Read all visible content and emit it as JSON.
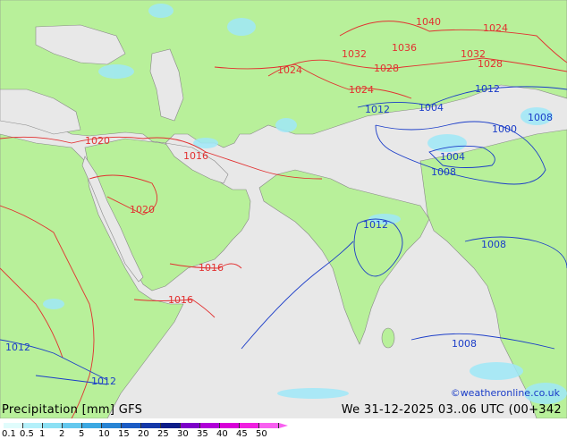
{
  "title": "Precipitation [mm]  GFS",
  "run_info": "We 31-12-2025 03..06 UTC (00+342",
  "credit": "©weatheronline.co.uk",
  "colors": {
    "land": "#b8f09a",
    "sea": "#e8e8e8",
    "isobar_high": "#e23030",
    "isobar_low": "#1a3cc8",
    "precip_light": "#9fe8f8"
  },
  "legend": {
    "ticks": [
      "0.1",
      "0.5",
      "1",
      "2",
      "5",
      "10",
      "15",
      "20",
      "25",
      "30",
      "35",
      "40",
      "45",
      "50"
    ],
    "colors": [
      "#e0fcfc",
      "#b4f0fa",
      "#8ce0f4",
      "#64c8ee",
      "#3ca8e2",
      "#2884d4",
      "#1c5cc4",
      "#1438a8",
      "#0c1c88",
      "#7c00c8",
      "#b000d8",
      "#d800d8",
      "#f020e0",
      "#f860f0"
    ]
  },
  "isobars_red": [
    "1040",
    "1024",
    "1036",
    "1032",
    "1028",
    "1032",
    "1028",
    "1024",
    "1024",
    "1020",
    "1016",
    "1020",
    "1016",
    "1016",
    "1012"
  ],
  "isobars_blue": [
    "1012",
    "1012",
    "1004",
    "1008",
    "1000",
    "1004",
    "1008",
    "1012",
    "1008",
    "1008",
    "1012",
    "1012"
  ]
}
